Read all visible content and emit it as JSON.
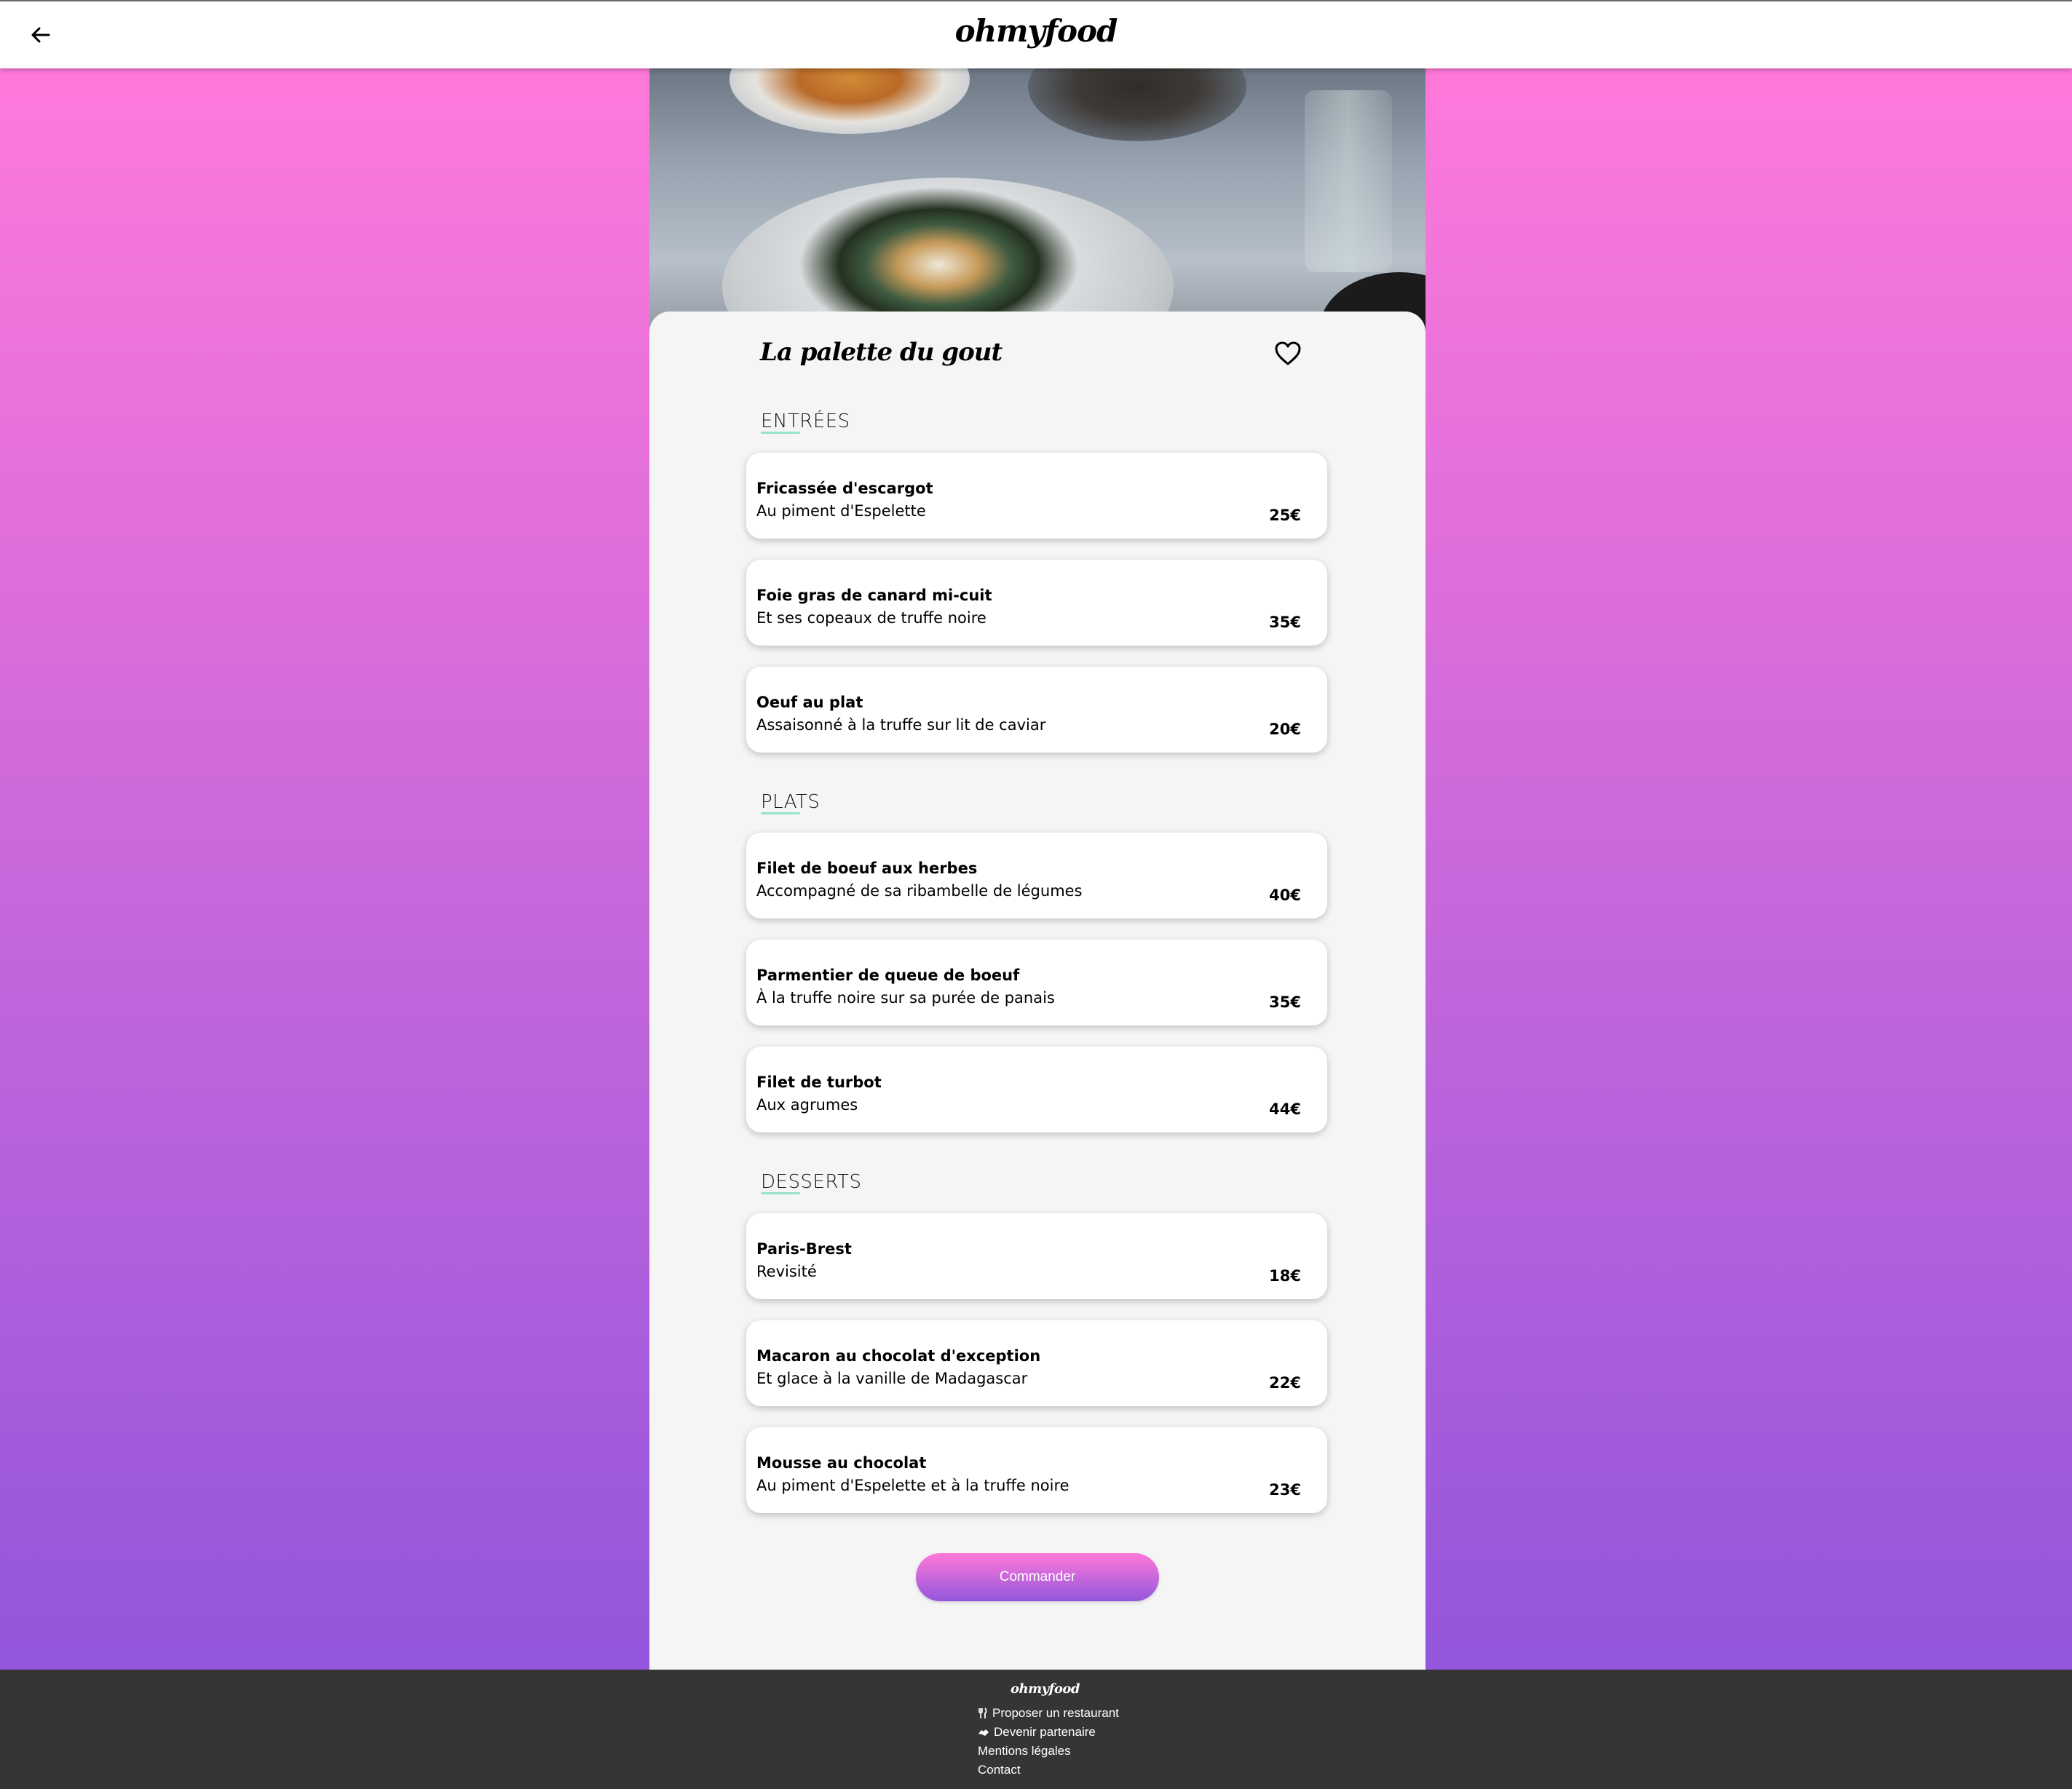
{
  "header": {
    "logo": "ohmyfood",
    "back_icon": "arrow-left-icon"
  },
  "restaurant": {
    "name": "La palette du gout",
    "favorite_icon": "heart-icon"
  },
  "sections": [
    {
      "title": "ENTRÉES",
      "dishes": [
        {
          "name": "Fricassée d'escargot",
          "description": "Au piment d'Espelette",
          "price": "25€"
        },
        {
          "name": "Foie gras de canard mi-cuit",
          "description": "Et ses copeaux de truffe noire",
          "price": "35€"
        },
        {
          "name": "Oeuf au plat",
          "description": "Assaisonné à la truffe sur lit de caviar",
          "price": "20€"
        }
      ]
    },
    {
      "title": "PLATS",
      "dishes": [
        {
          "name": "Filet de boeuf aux herbes",
          "description": "Accompagné de sa ribambelle de légumes",
          "price": "40€"
        },
        {
          "name": "Parmentier de queue de boeuf",
          "description": "À la truffe noire sur sa purée de panais",
          "price": "35€"
        },
        {
          "name": "Filet de turbot",
          "description": "Aux agrumes",
          "price": "44€"
        }
      ]
    },
    {
      "title": "DESSERTS",
      "dishes": [
        {
          "name": "Paris-Brest",
          "description": "Revisité",
          "price": "18€"
        },
        {
          "name": "Macaron au chocolat d'exception",
          "description": "Et glace à la vanille de Madagascar",
          "price": "22€"
        },
        {
          "name": "Mousse au chocolat",
          "description": "Au piment d'Espelette et à la truffe noire",
          "price": "23€"
        }
      ]
    }
  ],
  "order_button": "Commander",
  "footer": {
    "logo": "ohmyfood",
    "links": [
      {
        "label": "Proposer un restaurant",
        "icon": "utensils-icon"
      },
      {
        "label": "Devenir partenaire",
        "icon": "handshake-icon"
      },
      {
        "label": "Mentions légales",
        "icon": ""
      },
      {
        "label": "Contact",
        "icon": ""
      }
    ]
  },
  "colors": {
    "gradient_top": "#ff79da",
    "gradient_bottom": "#9356dc",
    "accent_underline": "#99e2d0",
    "footer_bg": "#353535",
    "card_bg": "#f5f5f5"
  }
}
